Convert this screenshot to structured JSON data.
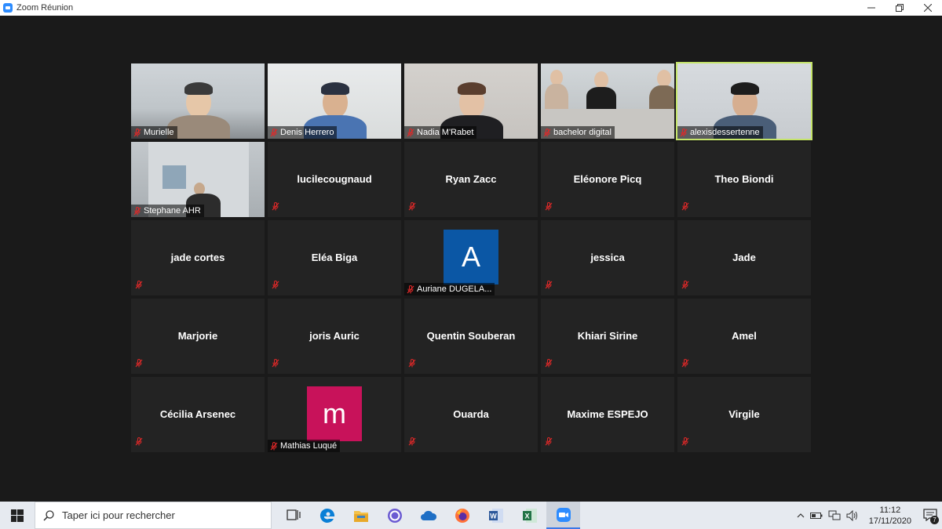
{
  "window": {
    "title": "Zoom Réunion"
  },
  "participants": [
    {
      "name": "Murielle",
      "video": true,
      "active": false,
      "scene": "v1"
    },
    {
      "name": "Denis Herrero",
      "video": true,
      "active": false,
      "scene": "v2"
    },
    {
      "name": "Nadia M'Rabet",
      "video": true,
      "active": false,
      "scene": "v3"
    },
    {
      "name": "bachelor digital",
      "video": true,
      "active": false,
      "scene": "v4"
    },
    {
      "name": "alexisdessertenne",
      "video": true,
      "active": true,
      "scene": "v5"
    },
    {
      "name": "Stephane AHR",
      "video": true,
      "active": false,
      "scene": "v6"
    },
    {
      "name": "lucilecougnaud",
      "video": false
    },
    {
      "name": "Ryan Zacc",
      "video": false
    },
    {
      "name": "Eléonore Picq",
      "video": false
    },
    {
      "name": "Theo Biondi",
      "video": false
    },
    {
      "name": "jade cortes",
      "video": false
    },
    {
      "name": "Eléa Biga",
      "video": false
    },
    {
      "name": "Auriane DUGELA...",
      "video": false,
      "avatar": {
        "letter": "A",
        "color": "#0b57a5"
      }
    },
    {
      "name": "jessica",
      "video": false
    },
    {
      "name": "Jade",
      "video": false
    },
    {
      "name": "Marjorie",
      "video": false
    },
    {
      "name": "joris Auric",
      "video": false
    },
    {
      "name": "Quentin Souberan",
      "video": false
    },
    {
      "name": "Khiari Sirine",
      "video": false
    },
    {
      "name": "Amel",
      "video": false
    },
    {
      "name": "Cécilia Arsenec",
      "video": false
    },
    {
      "name": "Mathias Luqué",
      "video": false,
      "avatar": {
        "letter": "m",
        "color": "#c8125a"
      }
    },
    {
      "name": "Ouarda",
      "video": false
    },
    {
      "name": "Maxime ESPEJO",
      "video": false
    },
    {
      "name": "Virgile",
      "video": false
    }
  ],
  "taskbar": {
    "search_placeholder": "Taper ici pour rechercher",
    "apps": [
      "task-view-icon",
      "edge-icon",
      "file-explorer-icon",
      "app-icon",
      "onedrive-icon",
      "firefox-icon",
      "word-icon",
      "excel-icon",
      "zoom-icon"
    ],
    "active_app": "zoom-icon",
    "time": "11:12",
    "date": "17/11/2020",
    "notifications": "7"
  },
  "colors": {
    "active_speaker": "#c5e46a",
    "mute_red": "#e02828",
    "tile_bg": "#232323"
  }
}
